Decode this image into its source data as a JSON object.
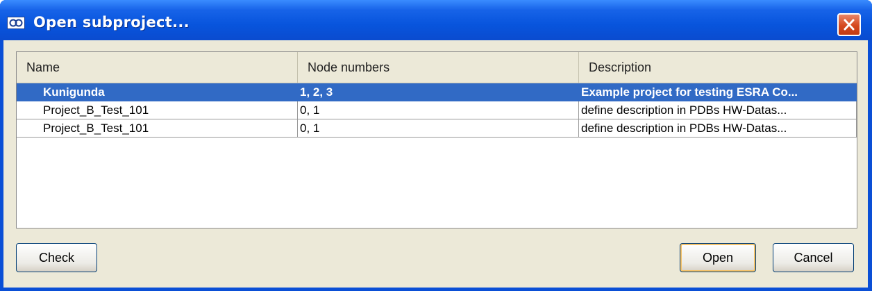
{
  "window": {
    "title": "Open subproject..."
  },
  "table": {
    "columns": [
      "Name",
      "Node numbers",
      "Description"
    ],
    "rows": [
      {
        "name": "Kunigunda",
        "nodes": "1, 2, 3",
        "description": "Example project for testing ESRA Co...",
        "selected": true
      },
      {
        "name": "Project_B_Test_101",
        "nodes": "0, 1",
        "description": "define description in PDBs HW-Datas...",
        "selected": false
      },
      {
        "name": "Project_B_Test_101",
        "nodes": "0, 1",
        "description": "define description in PDBs HW-Datas...",
        "selected": false
      }
    ]
  },
  "buttons": {
    "check": "Check",
    "open": "Open",
    "cancel": "Cancel"
  },
  "icons": {
    "app": "app-logo-icon",
    "close": "close-icon"
  },
  "colors": {
    "title_bar": "#0A4FD6",
    "selection": "#316AC5",
    "close_button": "#D5491F"
  }
}
